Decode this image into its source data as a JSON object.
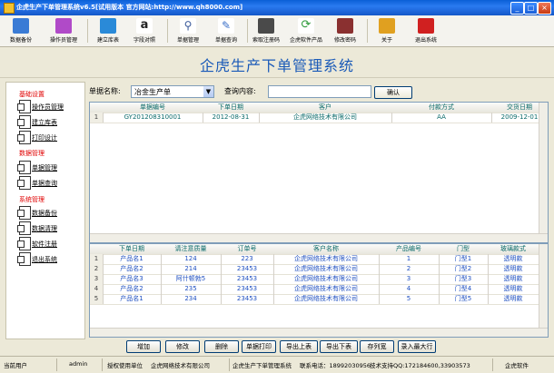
{
  "window": {
    "title": "企虎生产下单管理系统v6.5[试用版本 官方网站:http://www.qh8000.com]",
    "min": "_",
    "max": "□",
    "close": "×"
  },
  "toolbar": [
    {
      "label": "数据备份",
      "icon": "database-backup-icon",
      "color": "#3a7bd5"
    },
    {
      "label": "操作员管理",
      "icon": "operator-manage-icon",
      "color": "#b04ac8"
    },
    {
      "label": "建立库表",
      "icon": "create-table-icon",
      "color": "#2a8ad8"
    },
    {
      "label": "字段对照",
      "icon": "amazon-field-map-icon",
      "color": "#222222"
    },
    {
      "label": "单据管理",
      "icon": "magnifier-icon",
      "color": "#6c8fbf"
    },
    {
      "label": "单据查询",
      "icon": "pencil-icon",
      "color": "#3a6fc8"
    },
    {
      "label": "索取注册码",
      "icon": "register-key-icon",
      "color": "#4a4a4a"
    },
    {
      "label": "企虎软件产品",
      "icon": "refresh-products-icon",
      "color": "#2e9a3a"
    },
    {
      "label": "修改密码",
      "icon": "change-password-icon",
      "color": "#8a3030"
    },
    {
      "label": "关于",
      "icon": "about-folder-icon",
      "color": "#e0a020"
    },
    {
      "label": "退出系统",
      "icon": "exit-icon",
      "color": "#d02020"
    }
  ],
  "banner": {
    "title": "企虎生产下单管理系统"
  },
  "leftmenu": {
    "sections": [
      {
        "label": "基础设置",
        "items": [
          "操作员管理",
          "建立库表",
          "打印设计"
        ]
      },
      {
        "label": "数据管理",
        "items": [
          "单据管理",
          "单据查询"
        ]
      },
      {
        "label": "系统管理",
        "items": [
          "数据备份",
          "数据清理",
          "软件注册",
          "退出系统"
        ]
      }
    ]
  },
  "search": {
    "doc_label": "单据名称:",
    "doc_value": "冶金生产单",
    "query_label": "查询内容:",
    "query_value": "",
    "confirm": "确认"
  },
  "grid1": {
    "columns": [
      "",
      "单据编号",
      "下单日期",
      "客户",
      "付款方式",
      "交货日期"
    ],
    "rows": [
      [
        "1",
        "GY201208310001",
        "2012-08-31",
        "企虎网络技术有限公司",
        "AA",
        "2009-12-01"
      ]
    ]
  },
  "grid2": {
    "columns": [
      "",
      "下单日期",
      "请注意质量",
      "订单号",
      "客户名称",
      "产品编号",
      "门型",
      "玻璃款式"
    ],
    "rows": [
      [
        "1",
        "产品名1",
        "124",
        "223",
        "企虎网络技术有限公司",
        "1",
        "门型1",
        "透明款"
      ],
      [
        "2",
        "产品名2",
        "214",
        "23453",
        "企虎网络技术有限公司",
        "2",
        "门型2",
        "透明款"
      ],
      [
        "3",
        "产品名3",
        "阿什顿勃5",
        "23453",
        "企虎网络技术有限公司",
        "3",
        "门型3",
        "透明款"
      ],
      [
        "4",
        "产品名2",
        "235",
        "23453",
        "企虎网络技术有限公司",
        "4",
        "门型4",
        "透明款"
      ],
      [
        "5",
        "产品名1",
        "234",
        "23453",
        "企虎网络技术有限公司",
        "5",
        "门型5",
        "透明款"
      ]
    ]
  },
  "buttons": [
    "增加",
    "修改",
    "删除",
    "单据打印",
    "导出上表",
    "导出下表",
    "存列宽",
    "录入最大行"
  ],
  "status": {
    "user_label": "当前用户",
    "user": "admin",
    "unit_label": "授权使用单位",
    "unit": "企虎网络技术有限公司",
    "system": "企虎生产下单管理系统",
    "phone": "联系电话：18992030956",
    "qq": "技术支持QQ:172184600,33903573",
    "brand": "企虎软件"
  }
}
